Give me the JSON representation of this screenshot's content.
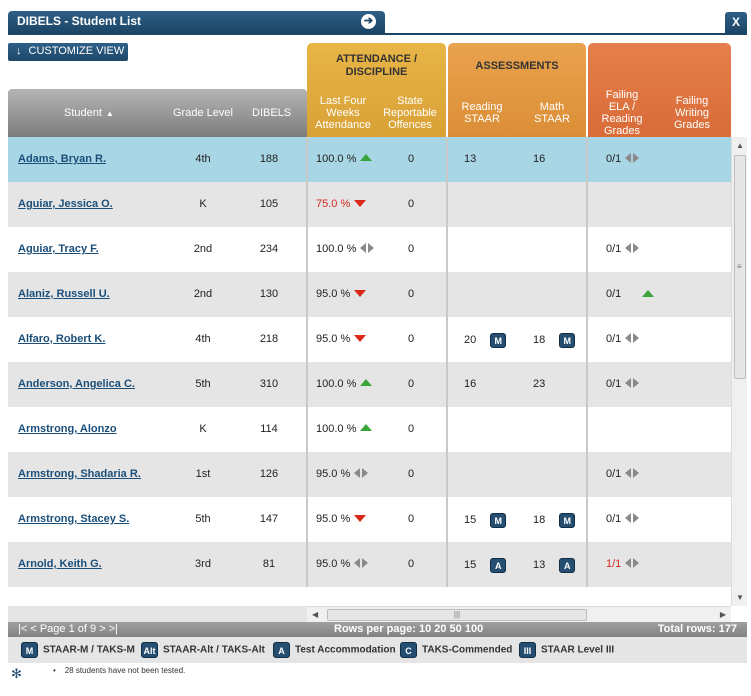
{
  "window": {
    "title": "DIBELS - Student List",
    "close_label": "X",
    "customize_label": "CUSTOMIZE VIEW"
  },
  "groups": {
    "attendance": "ATTENDANCE / DISCIPLINE",
    "assessments": "ASSESSMENTS"
  },
  "columns": {
    "student": "Student",
    "grade": "Grade Level",
    "dibels": "DIBELS",
    "last_four": "Last Four Weeks Attendance",
    "offences": "State Reportable Offences",
    "reading": "Reading STAAR",
    "math": "Math STAAR",
    "failing_ela": "Failing ELA / Reading Grades",
    "failing_writing": "Failing Writing Grades"
  },
  "rows": [
    {
      "name": "Adams, Bryan R.",
      "grade": "4th",
      "dibels": "188",
      "att": "100.0 %",
      "att_trend": "up",
      "off": "0",
      "read": "13",
      "read_badge": "",
      "math": "16",
      "math_badge": "",
      "ela": "0/1",
      "ela_trend": "flat",
      "selected": true
    },
    {
      "name": "Aguiar, Jessica O.",
      "grade": "K",
      "dibels": "105",
      "att": "75.0 %",
      "att_trend": "down",
      "att_red": true,
      "off": "0",
      "read": "",
      "read_badge": "",
      "math": "",
      "math_badge": "",
      "ela": "",
      "ela_trend": ""
    },
    {
      "name": "Aguiar, Tracy F.",
      "grade": "2nd",
      "dibels": "234",
      "att": "100.0 %",
      "att_trend": "flat",
      "off": "0",
      "read": "",
      "read_badge": "",
      "math": "",
      "math_badge": "",
      "ela": "0/1",
      "ela_trend": "flat"
    },
    {
      "name": "Alaniz, Russell U.",
      "grade": "2nd",
      "dibels": "130",
      "att": "95.0 %",
      "att_trend": "down",
      "off": "0",
      "read": "",
      "read_badge": "",
      "math": "",
      "math_badge": "",
      "ela": "0/1",
      "ela_trend": "up"
    },
    {
      "name": "Alfaro, Robert K.",
      "grade": "4th",
      "dibels": "218",
      "att": "95.0 %",
      "att_trend": "down",
      "off": "0",
      "read": "20",
      "read_badge": "M",
      "math": "18",
      "math_badge": "M",
      "ela": "0/1",
      "ela_trend": "flat"
    },
    {
      "name": "Anderson, Angelica C.",
      "grade": "5th",
      "dibels": "310",
      "att": "100.0 %",
      "att_trend": "up",
      "off": "0",
      "read": "16",
      "read_badge": "",
      "math": "23",
      "math_badge": "",
      "ela": "0/1",
      "ela_trend": "flat"
    },
    {
      "name": "Armstrong, Alonzo",
      "grade": "K",
      "dibels": "114",
      "att": "100.0 %",
      "att_trend": "up",
      "off": "0",
      "read": "",
      "read_badge": "",
      "math": "",
      "math_badge": "",
      "ela": "",
      "ela_trend": ""
    },
    {
      "name": "Armstrong, Shadaria R.",
      "grade": "1st",
      "dibels": "126",
      "att": "95.0 %",
      "att_trend": "flat",
      "off": "0",
      "read": "",
      "read_badge": "",
      "math": "",
      "math_badge": "",
      "ela": "0/1",
      "ela_trend": "flat"
    },
    {
      "name": "Armstrong, Stacey S.",
      "grade": "5th",
      "dibels": "147",
      "att": "95.0 %",
      "att_trend": "down",
      "off": "0",
      "read": "15",
      "read_badge": "M",
      "math": "18",
      "math_badge": "M",
      "ela": "0/1",
      "ela_trend": "flat"
    },
    {
      "name": "Arnold, Keith G.",
      "grade": "3rd",
      "dibels": "81",
      "att": "95.0 %",
      "att_trend": "flat",
      "off": "0",
      "read": "15",
      "read_badge": "A",
      "math": "13",
      "math_badge": "A",
      "ela": "1/1",
      "ela_red": true,
      "ela_trend": "flat"
    }
  ],
  "pager": {
    "first": "|<",
    "prev": "<",
    "page_text": "Page 1 of 9",
    "next": ">",
    "last": ">|",
    "rows_label": "Rows per page:",
    "rows_options": "10 20 50 100",
    "total": "Total rows: 177"
  },
  "legend": [
    {
      "code": "M",
      "label": "STAAR-M / TAKS-M"
    },
    {
      "code": "Alt",
      "label": "STAAR-Alt / TAKS-Alt"
    },
    {
      "code": "A",
      "label": "Test Accommodation"
    },
    {
      "code": "C",
      "label": "TAKS-Commended"
    },
    {
      "code": "III",
      "label": "STAAR Level III"
    }
  ],
  "note": "28 students have not been tested.",
  "colors": {
    "title_bar": "#1c4566",
    "attendance_header": "#e8b547",
    "assessments_header": "#e9a24e",
    "failing_header": "#e57f4c",
    "selected_row": "#a9d6e5",
    "trend_up": "#39a53b",
    "trend_down": "#d9281a"
  }
}
